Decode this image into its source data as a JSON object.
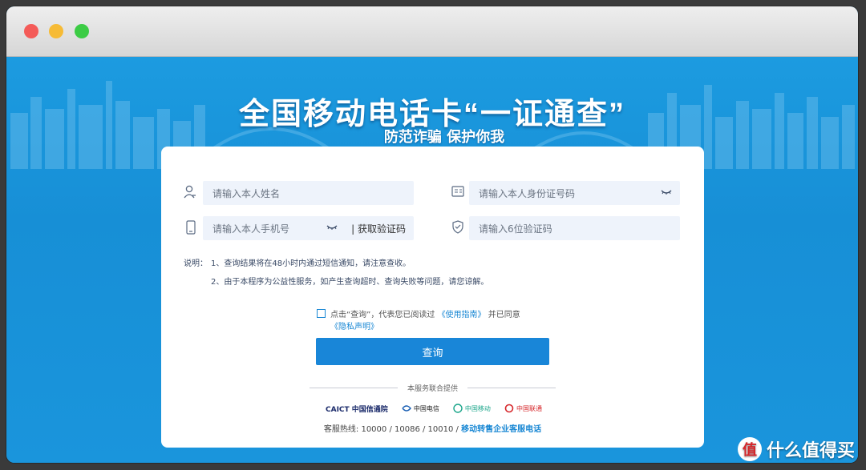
{
  "page": {
    "headline": "全国移动电话卡“一证通查”",
    "subheadline": "防范诈骗 保护你我"
  },
  "form": {
    "name_placeholder": "请输入本人姓名",
    "id_placeholder": "请输入本人身份证号码",
    "phone_placeholder": "请输入本人手机号",
    "get_code_label": "| 获取验证码",
    "code_placeholder": "请输入6位验证码"
  },
  "notes": {
    "label": "说明：",
    "line1": "1、查询结果将在48小时内通过短信通知，请注意查收。",
    "line2": "2、由于本程序为公益性服务，如产生查询超时、查询失败等问题，请您谅解。"
  },
  "agreement": {
    "prefix": "点击“查询”，代表您已阅读过",
    "guide_link": "《使用指南》",
    "middle": "并已同意",
    "privacy_link": "《隐私声明》"
  },
  "submit_label": "查询",
  "partners": {
    "title": "本服务联合提供",
    "logos": [
      "CAICT 中国信通院",
      "中国电信",
      "中国移动",
      "中国联通"
    ]
  },
  "hotline": {
    "prefix": "客服热线: 10000 / 10086 / 10010 /",
    "link": "移动转售企业客服电话"
  },
  "watermark": {
    "text": "什么值得买",
    "badge": "值"
  },
  "colors": {
    "banner_blue": "#1a96dc",
    "button_blue": "#1986d8",
    "link_blue": "#1a88d4",
    "field_bg": "#eef3fb"
  },
  "icons": [
    "user-icon",
    "id-card-icon",
    "phone-icon",
    "shield-icon",
    "eye-closed-icon"
  ]
}
